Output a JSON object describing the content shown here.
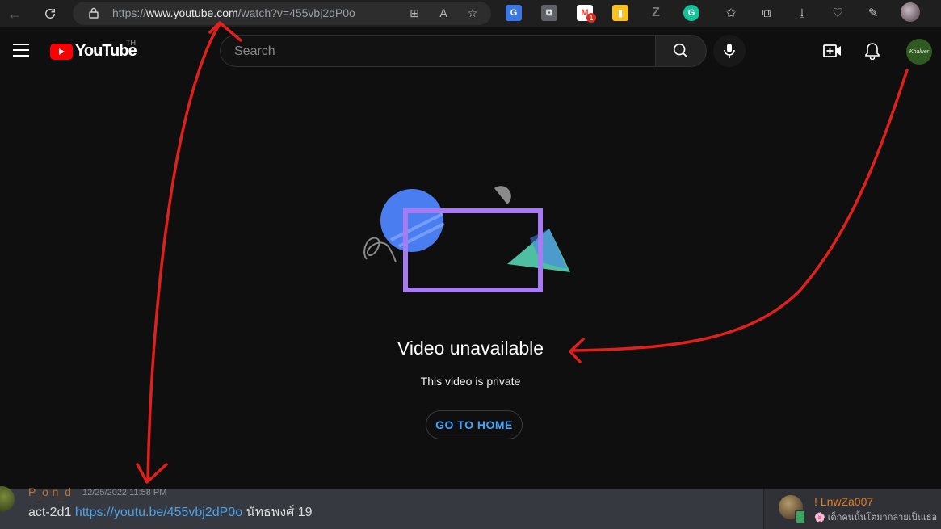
{
  "browser": {
    "url_prefix": "https://",
    "url_host": "www.youtube.com",
    "url_path": "/watch?v=455vbj2dP0o",
    "extensions": [
      {
        "icon": "translate-icon",
        "color": "#3b78e7",
        "label": "G"
      },
      {
        "icon": "copy-icon",
        "color": "#5f6368",
        "label": "⧉"
      },
      {
        "icon": "gmail-icon",
        "color": "#ea4335",
        "label": "M",
        "badge": "1"
      },
      {
        "icon": "keep-icon",
        "color": "#f6c026",
        "label": "▮"
      },
      {
        "icon": "z-icon",
        "color": "#6b6b6b",
        "label": "Z"
      },
      {
        "icon": "grammarly-icon",
        "color": "#15c39a",
        "label": "G"
      }
    ]
  },
  "youtube": {
    "logo_text": "YouTube",
    "region": "TH",
    "search_placeholder": "Search",
    "avatar_text": "Khaluer"
  },
  "main": {
    "title": "Video unavailable",
    "subtitle": "This video is private",
    "button_label": "GO TO HOME"
  },
  "discord": {
    "username": "P_o-n_d",
    "timestamp": "12/25/2022 11:58 PM",
    "message_prefix": "act-2d1",
    "message_link": "https://youtu.be/455vbj2dP0o",
    "message_suffix": "นัทธพงศ์ 19",
    "side_user": "! LnwZa007",
    "side_activity": "🌸 เด็กคนนั้นโตมากลายเป็นเธอ"
  },
  "colors": {
    "accent_blue": "#3ea6ff",
    "youtube_red": "#ff0000",
    "annotation_red": "#e0201c"
  }
}
